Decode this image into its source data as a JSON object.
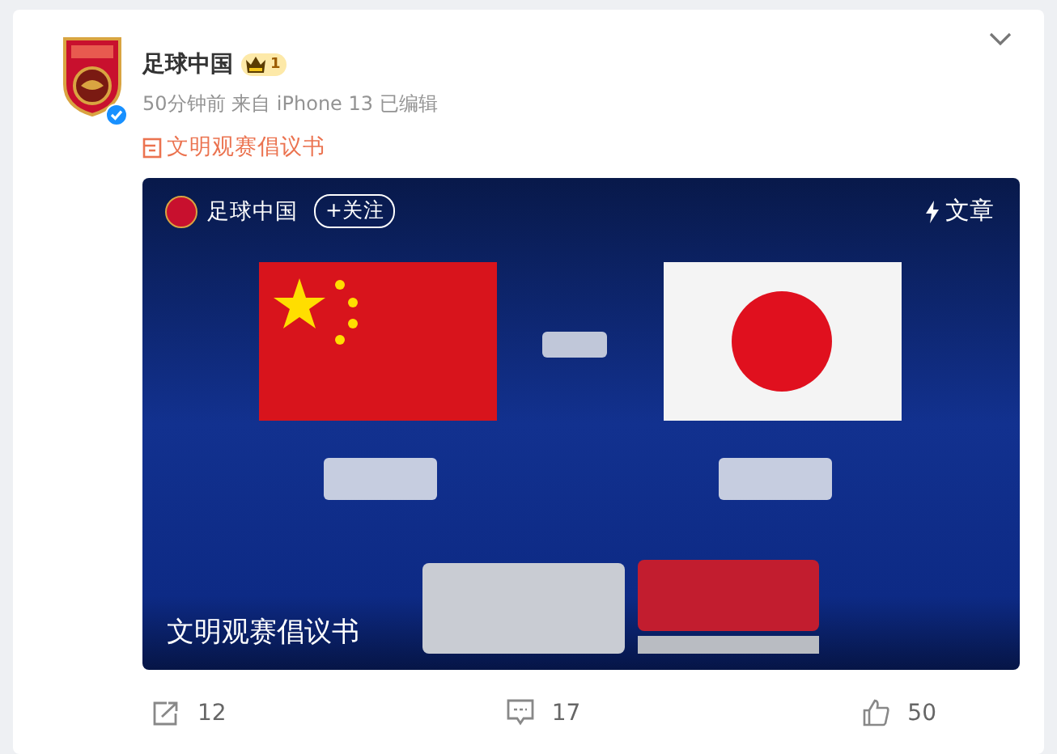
{
  "post": {
    "author": {
      "name": "足球中国",
      "verified": true,
      "member_badge": "1"
    },
    "meta": {
      "time": "50分钟前",
      "source": "来自 iPhone 13",
      "edited": "已编辑"
    },
    "link": {
      "text": "文明观赛倡议书"
    },
    "media": {
      "kind": "picture",
      "account": "足球中国",
      "follow_button": "+关注",
      "type_label": "文章",
      "caption": "文明观赛倡议书"
    },
    "actions": [
      {
        "kind": "share",
        "count": "12"
      },
      {
        "kind": "comment",
        "count": "17"
      },
      {
        "kind": "like",
        "count": "50"
      }
    ]
  }
}
